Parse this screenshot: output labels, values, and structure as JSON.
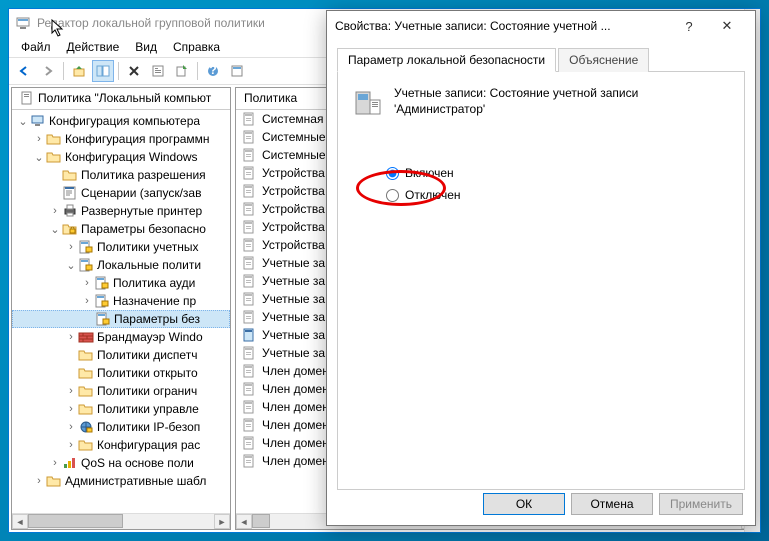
{
  "window": {
    "title": "Редактор локальной групповой политики"
  },
  "menu": {
    "file": "Файл",
    "action": "Действие",
    "view": "Вид",
    "help": "Справка"
  },
  "tree_header": "Политика \"Локальный компьют",
  "tree": [
    {
      "indent": 0,
      "exp": "v",
      "icon": "computer",
      "label": "Конфигурация компьютера"
    },
    {
      "indent": 1,
      "exp": ">",
      "icon": "folder",
      "label": "Конфигурация программн"
    },
    {
      "indent": 1,
      "exp": "v",
      "icon": "folder",
      "label": "Конфигурация Windows"
    },
    {
      "indent": 2,
      "exp": "",
      "icon": "folder",
      "label": "Политика разрешения"
    },
    {
      "indent": 2,
      "exp": "",
      "icon": "script",
      "label": "Сценарии (запуск/зав"
    },
    {
      "indent": 2,
      "exp": ">",
      "icon": "printer",
      "label": "Развернутые принтер"
    },
    {
      "indent": 2,
      "exp": "v",
      "icon": "security",
      "label": "Параметры безопасно"
    },
    {
      "indent": 3,
      "exp": ">",
      "icon": "policy",
      "label": "Политики учетных"
    },
    {
      "indent": 3,
      "exp": "v",
      "icon": "policy",
      "label": "Локальные полити"
    },
    {
      "indent": 4,
      "exp": ">",
      "icon": "policy",
      "label": "Политика ауди"
    },
    {
      "indent": 4,
      "exp": ">",
      "icon": "policy",
      "label": "Назначение пр"
    },
    {
      "indent": 4,
      "exp": "",
      "icon": "policy",
      "label": "Параметры без",
      "selected": true
    },
    {
      "indent": 3,
      "exp": ">",
      "icon": "firewall",
      "label": "Брандмауэр Windo"
    },
    {
      "indent": 3,
      "exp": "",
      "icon": "folder",
      "label": "Политики диспетч"
    },
    {
      "indent": 3,
      "exp": "",
      "icon": "folder",
      "label": "Политики открыто"
    },
    {
      "indent": 3,
      "exp": ">",
      "icon": "folder",
      "label": "Политики огранич"
    },
    {
      "indent": 3,
      "exp": ">",
      "icon": "folder",
      "label": "Политики управле"
    },
    {
      "indent": 3,
      "exp": ">",
      "icon": "ipsec",
      "label": "Политики IP-безоп"
    },
    {
      "indent": 3,
      "exp": ">",
      "icon": "folder",
      "label": "Конфигурация рас"
    },
    {
      "indent": 2,
      "exp": ">",
      "icon": "qos",
      "label": "QoS на основе поли"
    },
    {
      "indent": 1,
      "exp": ">",
      "icon": "folder",
      "label": "Административные шабл"
    }
  ],
  "list_header": "Политика",
  "list": [
    "Системная",
    "Системные",
    "Системные",
    "Устройства",
    "Устройства",
    "Устройства",
    "Устройства",
    "Устройства",
    "Учетные за",
    "Учетные за",
    "Учетные за",
    "Учетные за",
    "Учетные за",
    "Учетные за",
    "Член домен",
    "Член домен",
    "Член домен",
    "Член домен",
    "Член домен",
    "Член домен"
  ],
  "dialog": {
    "title": "Свойства: Учетные записи: Состояние учетной ...",
    "tab1": "Параметр локальной безопасности",
    "tab2": "Объяснение",
    "desc_line1": "Учетные записи: Состояние учетной записи",
    "desc_line2": "'Администратор'",
    "opt_enabled": "Включен",
    "opt_disabled": "Отключен",
    "btn_ok": "ОК",
    "btn_cancel": "Отмена",
    "btn_apply": "Применить"
  }
}
